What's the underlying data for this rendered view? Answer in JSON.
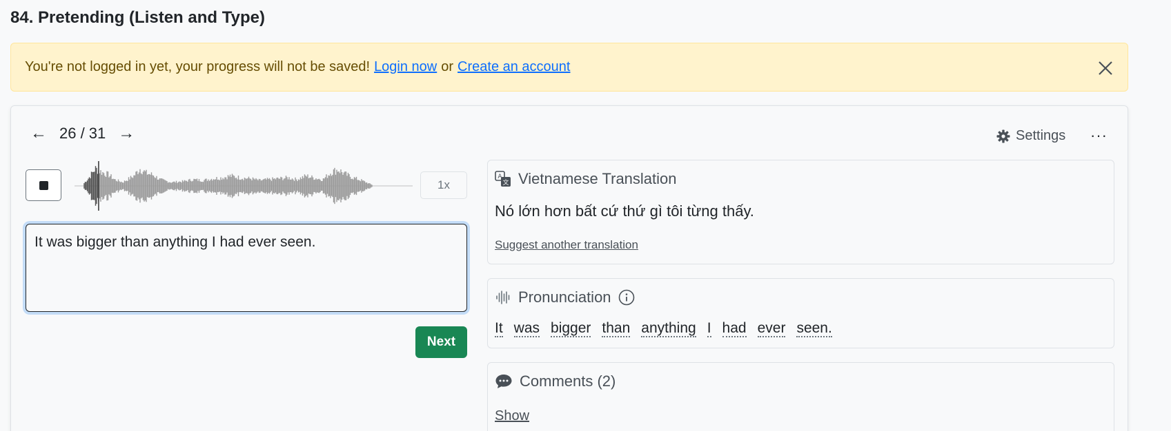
{
  "page": {
    "title": "84. Pretending (Listen and Type)"
  },
  "alert": {
    "message": "You're not logged in yet, your progress will not be saved!",
    "login_link": "Login now",
    "or_text": "or",
    "create_link": "Create an account",
    "close_icon": "close-icon"
  },
  "nav": {
    "prev_icon": "←",
    "counter": "26 / 31",
    "next_icon": "→"
  },
  "toolbar": {
    "settings_label": "Settings",
    "more_label": "···"
  },
  "player": {
    "speed_label": "1x",
    "progress": 0.05
  },
  "answer": {
    "value": "It was bigger than anything I had ever seen."
  },
  "next_button": {
    "label": "Next"
  },
  "translation": {
    "title": "Vietnamese Translation",
    "text": "Nó lớn hơn bất cứ thứ gì tôi từng thấy.",
    "suggest_link": "Suggest another translation"
  },
  "pronunciation": {
    "title": "Pronunciation",
    "words": [
      "It",
      "was",
      "bigger",
      "than",
      "anything",
      "I",
      "had",
      "ever",
      "seen."
    ]
  },
  "comments": {
    "title": "Comments (2)",
    "show_link": "Show"
  },
  "colors": {
    "alert_bg": "#fff3cd",
    "link": "#0d6efd",
    "next_button": "#198754",
    "focus_ring": "#c3dcf7"
  }
}
